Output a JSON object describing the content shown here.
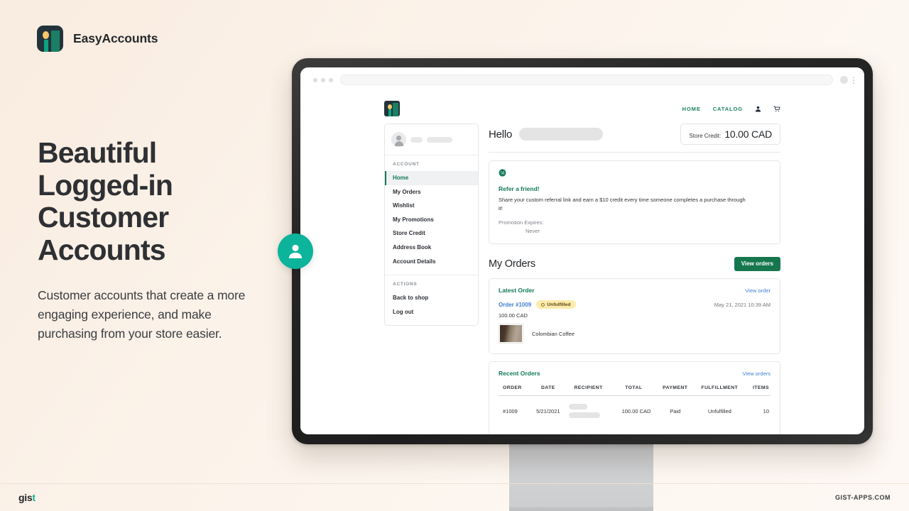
{
  "brand": {
    "name": "EasyAccounts",
    "logo_icon": "easyaccounts-logo-icon"
  },
  "hero": {
    "headline_line1": "Beautiful",
    "headline_line2": "Logged-in",
    "headline_line3": "Customer",
    "headline_line4": "Accounts",
    "subcopy": "Customer accounts that create a more engaging experience, and make purchasing from your store easier."
  },
  "browser": {
    "url_value": "",
    "url_placeholder": "",
    "menu_icon": "kebab-menu-icon",
    "profile_icon": "browser-profile-icon"
  },
  "storefront": {
    "logo_icon": "store-logo-icon",
    "nav": [
      {
        "label": "HOME"
      },
      {
        "label": "CATALOG"
      }
    ],
    "account_icon": "person-icon",
    "cart_icon": "cart-icon"
  },
  "sidebar": {
    "avatar_icon": "user-avatar-icon",
    "sections": [
      {
        "label": "ACCOUNT",
        "items": [
          {
            "label": "Home",
            "active": true
          },
          {
            "label": "My Orders",
            "active": false
          },
          {
            "label": "Wishlist",
            "active": false
          },
          {
            "label": "My Promotions",
            "active": false
          },
          {
            "label": "Store Credit",
            "active": false
          },
          {
            "label": "Address Book",
            "active": false
          },
          {
            "label": "Account Details",
            "active": false
          }
        ]
      },
      {
        "label": "ACTIONS",
        "items": [
          {
            "label": "Back to shop",
            "active": false
          },
          {
            "label": "Log out",
            "active": false
          }
        ]
      }
    ]
  },
  "main": {
    "greeting": "Hello",
    "store_credit_label": "Store Credit:",
    "store_credit_value": "10.00 CAD",
    "promo": {
      "icon": "discount-badge-icon",
      "title": "Refer a friend!",
      "text": "Share your custom referral link and earn a $10 credit every time someone completes a purchase through it!",
      "expires_label": "Promotion Expires:",
      "expires_value": "Never"
    },
    "orders": {
      "title": "My Orders",
      "view_orders_button": "View orders",
      "latest": {
        "title": "Latest Order",
        "view_order_link": "View order",
        "order_number": "Order #1009",
        "status": "Unfulfilled",
        "date": "May 21, 2021 10:39 AM",
        "total": "100.00 CAD",
        "product_name": "Colombian Coffee",
        "product_image_icon": "coffee-beans-thumbnail"
      },
      "recent": {
        "title": "Recent Orders",
        "view_orders_link": "View orders",
        "columns": [
          "ORDER",
          "DATE",
          "RECIPIENT",
          "TOTAL",
          "PAYMENT",
          "FULFILLMENT",
          "ITEMS"
        ],
        "rows": [
          {
            "order": "#1009",
            "date": "5/21/2021",
            "recipient": "",
            "total": "100.00 CAD",
            "payment": "Paid",
            "fulfillment": "Unfulfilled",
            "items": "10"
          }
        ]
      }
    }
  },
  "floating_badge": {
    "icon": "person-badge-icon",
    "color": "#0bb49a"
  },
  "footer": {
    "logo_text": "gis",
    "logo_accent": "t",
    "url": "GIST-APPS.COM"
  },
  "colors": {
    "background_start": "#f9ece0",
    "background_end": "#fdf8f3",
    "brand_dark": "#22333b",
    "green": "#16774e",
    "teal": "#0bb49a",
    "link_blue": "#3f7fd4",
    "badge_yellow": "#fcebab"
  }
}
